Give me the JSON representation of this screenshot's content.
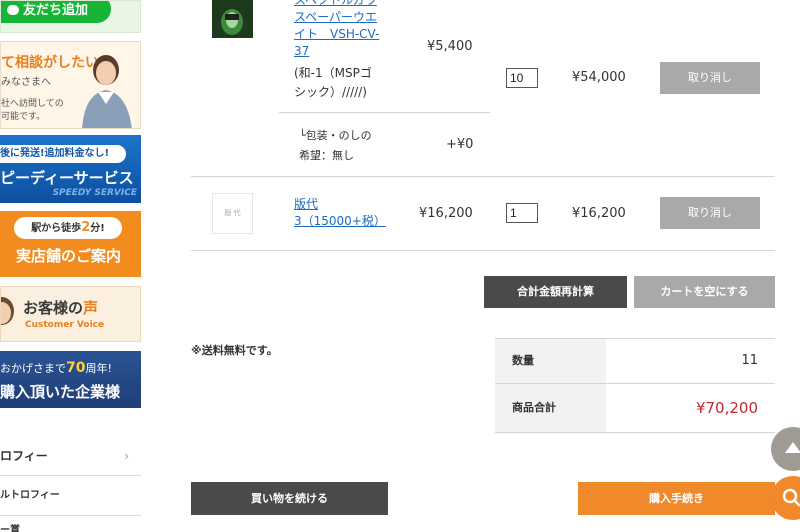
{
  "sidebar": {
    "line_banner": "友だち追加",
    "consult_banner": {
      "title": "て相談がしたい」",
      "sub": "みなさまへ",
      "desc1": "社へ訪問しての",
      "desc2": "可能です。"
    },
    "speedy_banner": {
      "top": "後に発送!追加料金なし!",
      "main": "ピーディーサービス",
      "tag": "SPEEDY SERVICE"
    },
    "store_banner": {
      "bubble_prefix": "駅から徒歩",
      "bubble_num": "2",
      "bubble_suffix": "分!",
      "main": "実店舗のご案内"
    },
    "voice_banner": {
      "main_prefix": "お客様の",
      "main_accent": "声",
      "sub": "Customer Voice"
    },
    "corp_banner": {
      "line1_prefix": "おかげさまで",
      "line1_num": "70",
      "line1_suffix": "周年!",
      "line2": "購入頂いた企業様"
    },
    "categories": [
      {
        "label": "ロフィー",
        "chevron": "›"
      },
      {
        "label": "ルトロフィー"
      },
      {
        "label": "ー賞"
      }
    ]
  },
  "cart": {
    "items": [
      {
        "name_lines": [
          "スペクトルガラ",
          "スペーパーウエ",
          "イト　VSH-CV-",
          "37"
        ],
        "option_lines": [
          "(和-1（MSPゴ",
          "シック）/////)"
        ],
        "unit_price": "¥5,400",
        "qty": "10",
        "subtotal": "¥54,000",
        "remove_label": "取り消し",
        "wrap_lines": [
          "└包装・のしの",
          "希望：無し"
        ],
        "wrap_price": "+¥0"
      },
      {
        "name_lines": [
          "版代",
          "3（15000+税）"
        ],
        "thumb_text": "版 代",
        "unit_price": "¥16,200",
        "qty": "1",
        "subtotal": "¥16,200",
        "remove_label": "取り消し"
      }
    ],
    "recalc_label": "合計金額再計算",
    "empty_label": "カートを空にする",
    "shipping_note": "※送料無料です。",
    "summary": {
      "qty_label": "数量",
      "qty_value": "11",
      "total_label": "商品合計",
      "total_value": "¥70,200"
    },
    "continue_label": "買い物を続ける",
    "checkout_label": "購入手続き"
  },
  "colors": {
    "accent_orange": "#f0892a",
    "price_red": "#c0282d",
    "link_blue": "#1e6bc3"
  },
  "icons": {
    "scroll_top": "up-triangle-icon",
    "search": "search-icon"
  }
}
